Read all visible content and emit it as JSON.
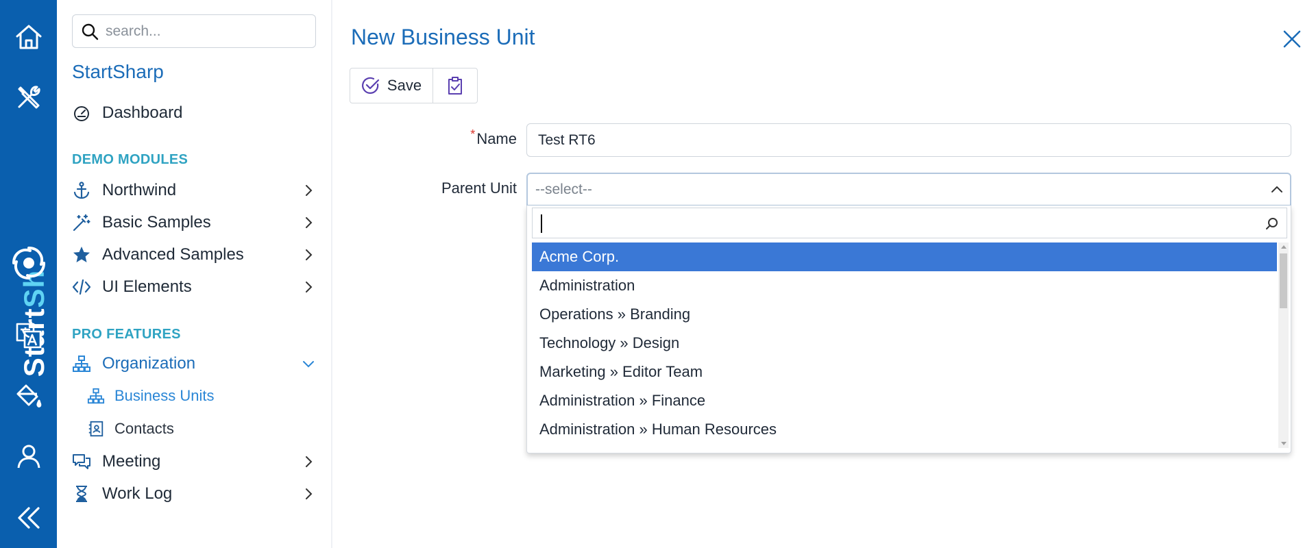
{
  "rail": {
    "brand_text_main": "Start",
    "brand_text_accent": "Sh",
    "buttons": [
      {
        "icon": "home-icon"
      },
      {
        "icon": "tools-icon"
      },
      {
        "icon": "translate-icon"
      },
      {
        "icon": "paint-bucket-icon"
      },
      {
        "icon": "user-icon"
      },
      {
        "icon": "double-chevron-left-icon"
      }
    ]
  },
  "sidebar": {
    "search_placeholder": "search...",
    "brand_title": "StartSharp",
    "dashboard": "Dashboard",
    "section_demo": "DEMO MODULES",
    "demo_items": [
      {
        "label": "Northwind",
        "icon": "anchor-icon"
      },
      {
        "label": "Basic Samples",
        "icon": "magic-wand-icon"
      },
      {
        "label": "Advanced Samples",
        "icon": "star-icon"
      },
      {
        "label": "UI Elements",
        "icon": "code-icon"
      }
    ],
    "section_pro": "PRO FEATURES",
    "organization": "Organization",
    "org_children": [
      {
        "label": "Business Units",
        "icon": "sitemap-icon"
      },
      {
        "label": "Contacts",
        "icon": "contact-card-icon"
      }
    ],
    "pro_items": [
      {
        "label": "Meeting",
        "icon": "chat-bubbles-icon"
      },
      {
        "label": "Work Log",
        "icon": "hourglass-icon"
      }
    ]
  },
  "main": {
    "title": "New Business Unit",
    "toolbar": {
      "save_label": "Save"
    },
    "form": {
      "name_label": "Name",
      "name_value": "Test RT6",
      "parent_label": "Parent Unit",
      "parent_placeholder": "--select--"
    },
    "dropdown": {
      "search_value": "",
      "options": [
        "Acme Corp.",
        "Administration",
        "Operations » Branding",
        "Technology » Design",
        "Marketing » Editor Team",
        "Administration » Finance",
        "Administration » Human Resources"
      ],
      "selected_index": 0
    }
  },
  "colors": {
    "rail_bg": "#0a5fae",
    "accent": "#1b6cb8",
    "section": "#2fa3c2",
    "selected_option": "#3a78d6"
  }
}
